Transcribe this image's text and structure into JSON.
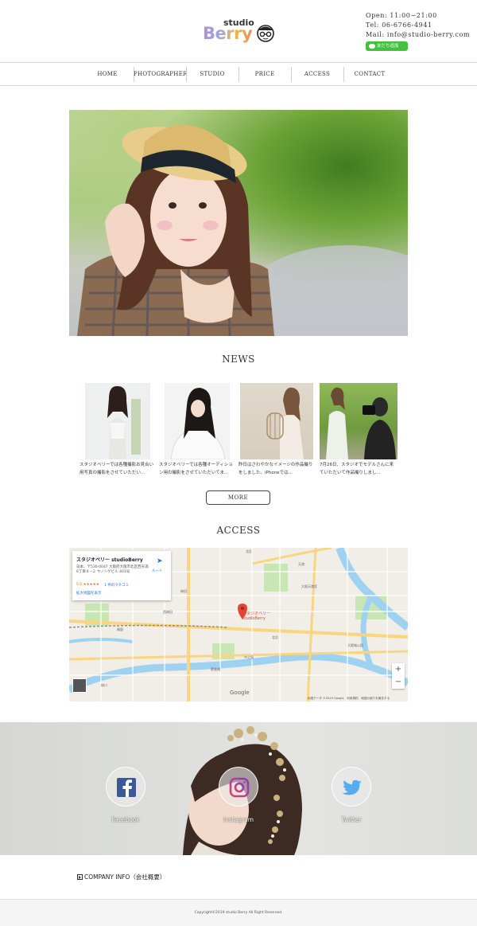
{
  "header": {
    "logo_small": "studio",
    "logo_main": "Berry",
    "open_hours": "Open: 11:00~21:00",
    "tel": "Tel: 06-6766-4941",
    "mail": "Mail: info@studio-berry.com",
    "line_button": "友だち追加"
  },
  "nav": {
    "items": [
      "HOME",
      "PHOTOGRAPHER",
      "STUDIO",
      "PRICE",
      "ACCESS",
      "CONTACT"
    ]
  },
  "news": {
    "title": "NEWS",
    "items": [
      {
        "text": "スタジオベリーでは各種撮影お見合い用写真の撮影をさせていただい..."
      },
      {
        "text": "スタジオベリーでは各種オーディション用の撮影をさせていただいてま..."
      },
      {
        "text": "昨日はさわやかなイメージの作品撮りをしました。iPhoneでは..."
      },
      {
        "text": "7月26日、スタジオでモデルさんに来ていただいて作品撮りしまし..."
      }
    ],
    "more_button": "MORE"
  },
  "access": {
    "title": "ACCESS",
    "map": {
      "place_name": "スタジオベリー studioBerry",
      "address": "日本、〒530-0047 大阪府大阪市北区西天満6丁目８−２ ヤノシゲビル 401号",
      "route_label": "ルート",
      "rating": "5.0 ★★★★★",
      "reviews": "1 件のクチコミ",
      "larger_map": "拡大地図を表示",
      "pin_label": "スタジオベリー studioBerry",
      "google_logo": "Google",
      "footer": "地図データ ©2019 Google　利用規約　地図の誤りを報告する",
      "zoom_in": "+",
      "zoom_out": "−",
      "labels": [
        "北区",
        "天満",
        "大阪天満宮",
        "大阪城公園",
        "中之島",
        "肥後橋",
        "北浜",
        "梅田",
        "福島",
        "西梅田",
        "桜川"
      ]
    }
  },
  "social": {
    "facebook": "Facebook",
    "instagram": "Instagram",
    "twitter": "Twitter"
  },
  "company_info": "COMPANY INFO（会社概要）",
  "footer": {
    "copyright": "Copyright©2019 studio Berry All Right Reserved."
  },
  "colors": {
    "line_green": "#41c13c",
    "facebook_blue": "#3b5998",
    "instagram_purple": "#9b36b7",
    "twitter_blue": "#55acee",
    "map_pin_red": "#e24536"
  }
}
